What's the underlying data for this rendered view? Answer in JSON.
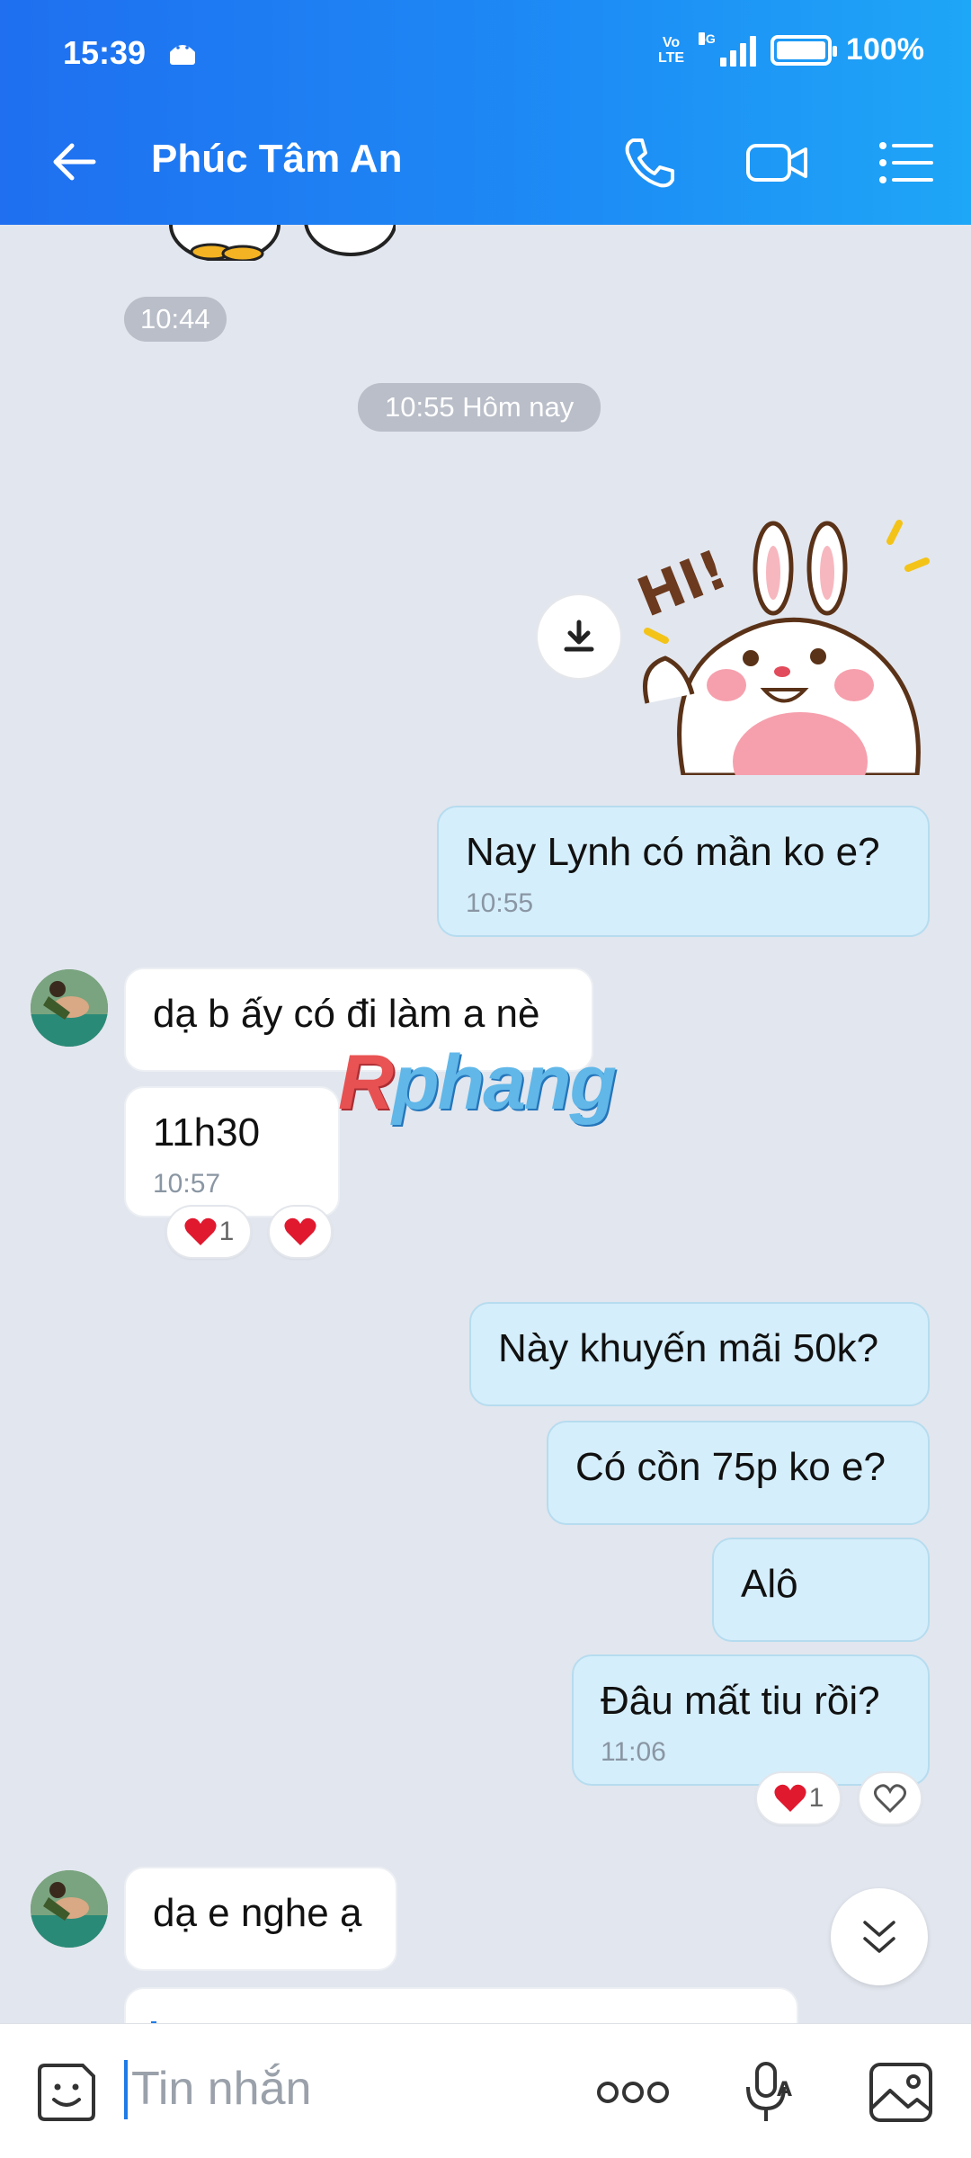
{
  "status_bar": {
    "time": "15:39",
    "volte_top": "Vo",
    "volte_bottom": "LTE",
    "network": "5G",
    "battery_percent": "100%"
  },
  "header": {
    "contact_name": "Phúc Tâm An",
    "icons": [
      "back-arrow-icon",
      "phone-icon",
      "video-call-icon",
      "menu-list-icon"
    ]
  },
  "messages": {
    "sticker_penguin_time": "10:44",
    "date_divider": "10:55 Hôm nay",
    "sent_1": {
      "text": "Nay Lynh có mần ko e?",
      "time": "10:55"
    },
    "recv_1": {
      "text": "dạ b ấy có đi làm a nè"
    },
    "recv_2": {
      "text": "11h30",
      "time": "10:57",
      "reaction_count": "1"
    },
    "sent_2": {
      "text": "Này khuyến mãi 50k?"
    },
    "sent_3": {
      "text": "Có cồn 75p ko e?"
    },
    "sent_4": {
      "text": "Alô"
    },
    "sent_5": {
      "text": "Đâu mất tiu rồi?",
      "time": "11:06",
      "reaction_count": "1"
    },
    "recv_3": {
      "text": "dạ e nghe ạ"
    }
  },
  "watermark": {
    "first": "R",
    "rest": "phang"
  },
  "input": {
    "placeholder": "Tin nhắn"
  },
  "colors": {
    "header_start": "#1f6ff0",
    "header_end": "#1ea6f7",
    "sent_bubble": "#d5eefb",
    "received_bubble": "#ffffff",
    "background": "#e2e6ee",
    "heart": "#e0192f"
  }
}
